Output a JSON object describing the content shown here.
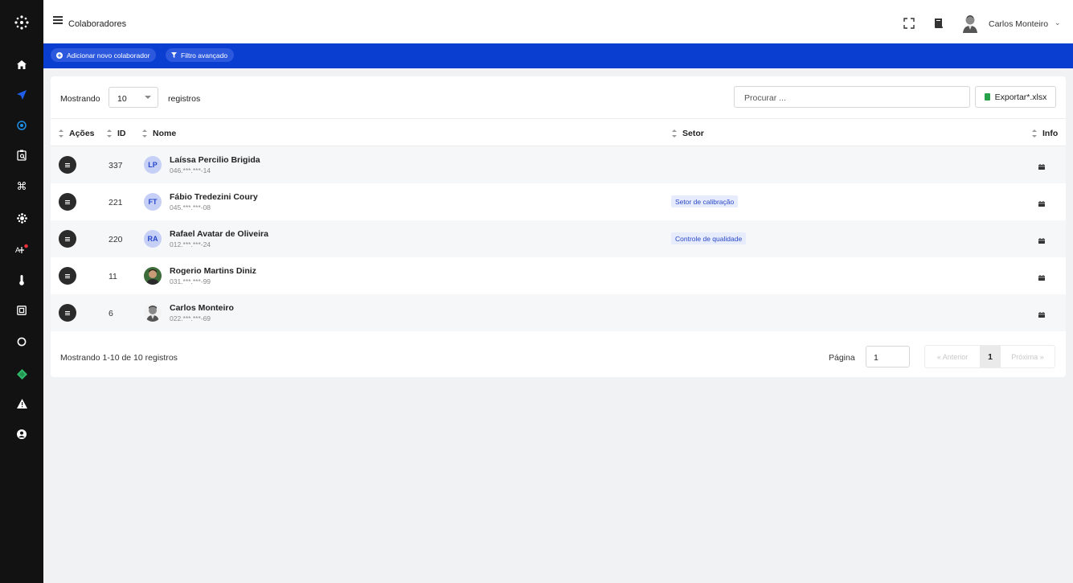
{
  "header": {
    "title": "Colaboradores",
    "user_name": "Carlos Monteiro",
    "icons": [
      "fullscreen-icon",
      "book-icon"
    ]
  },
  "sidebar": {
    "items": [
      {
        "icon": "home-icon"
      },
      {
        "icon": "send-icon",
        "color": "#1e5ee8"
      },
      {
        "icon": "target-icon",
        "color": "#1e90e8"
      },
      {
        "icon": "clipboard-search-icon"
      },
      {
        "icon": "command-icon"
      },
      {
        "icon": "gears-icon"
      },
      {
        "icon": "network-icon",
        "badge_color": "#e8323c"
      },
      {
        "icon": "thermometer-icon"
      },
      {
        "icon": "memory-chip-icon"
      },
      {
        "icon": "ring-icon"
      },
      {
        "icon": "diamond-icon",
        "color": "#2fb86a"
      },
      {
        "icon": "warning-icon"
      },
      {
        "icon": "user-circle-icon"
      }
    ]
  },
  "actions": {
    "add_label": "Adicionar novo colaborador",
    "filter_label": "Filtro avançado"
  },
  "colors": {
    "action_bar": "#0a3ed1",
    "sidebar": "#121212",
    "badge_bg": "#e7ecfd",
    "badge_text": "#2947c4",
    "avatar_bg": "#c6d0f7"
  },
  "table_controls": {
    "showing_label": "Mostrando",
    "page_size": "10",
    "records_label": "registros",
    "search_placeholder": "Procurar ...",
    "export_label": "Exportar*.xlsx"
  },
  "columns": {
    "actions": "Ações",
    "id": "ID",
    "name": "Nome",
    "sector": "Setor",
    "info": "Info"
  },
  "rows": [
    {
      "id": "337",
      "initials": "LP",
      "name": "Laíssa Percilio Brigida",
      "doc": "046.***.***-14",
      "sector": ""
    },
    {
      "id": "221",
      "initials": "FT",
      "name": "Fábio Tredezini Coury",
      "doc": "045.***.***-08",
      "sector": "Setor de calibração"
    },
    {
      "id": "220",
      "initials": "RA",
      "name": "Rafael Avatar de Oliveira",
      "doc": "012.***.***-24",
      "sector": "Controle de qualidade"
    },
    {
      "id": "11",
      "initials": "",
      "name": "Rogerio Martins Diniz",
      "doc": "031.***.***-99",
      "sector": ""
    },
    {
      "id": "6",
      "initials": "",
      "name": "Carlos Monteiro",
      "doc": "022.***.***-69",
      "sector": ""
    }
  ],
  "footer": {
    "summary": "Mostrando 1-10 de 10 registros",
    "page_label": "Página",
    "page_value": "1",
    "prev_label": "« Anterior",
    "current_page": "1",
    "next_label": "Próxima »"
  }
}
